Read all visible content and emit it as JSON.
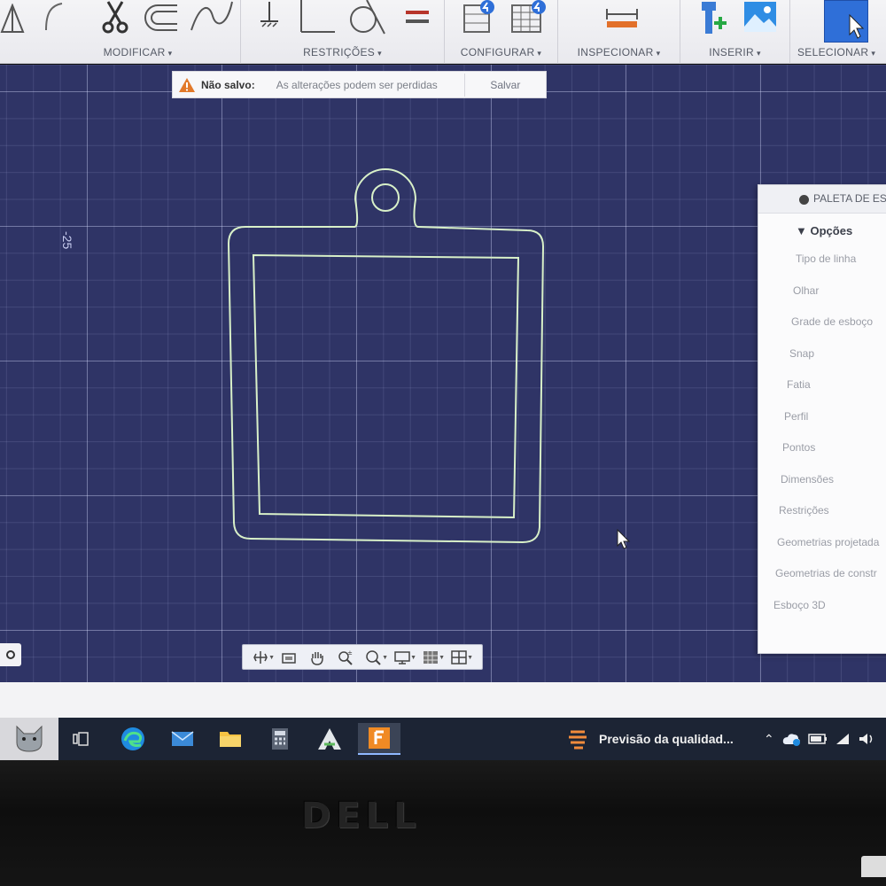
{
  "ribbon": {
    "groups": [
      {
        "label": "MODIFICAR"
      },
      {
        "label": "RESTRIÇÕES"
      },
      {
        "label": "CONFIGURAR"
      },
      {
        "label": "INSPECIONAR"
      },
      {
        "label": "INSERIR"
      },
      {
        "label": "SELECIONAR"
      }
    ],
    "caret": "▾",
    "colors": {
      "accent_blue": "#2f6fd8",
      "constraint_red": "#c0392b",
      "inspect_orange": "#e2702a"
    }
  },
  "banner": {
    "icon": "warning-icon",
    "title": "Não salvo:",
    "message": "As alterações podem ser perdidas",
    "save_label": "Salvar"
  },
  "canvas": {
    "dimension_label": "-25",
    "background": "#2f3466",
    "sketch_line_color": "#d8f0c8"
  },
  "navbar": {
    "tools": [
      "orbit-icon",
      "look-at-icon",
      "pan-icon",
      "zoom-window-icon",
      "zoom-icon",
      "display-icon",
      "grid-icon",
      "viewports-icon"
    ]
  },
  "palette": {
    "title": "PALETA DE ES",
    "section": "Opções",
    "options": [
      "Tipo de linha",
      "Olhar",
      "Grade de esboço",
      "Snap",
      "Fatia",
      "Perfil",
      "Pontos",
      "Dimensões",
      "Restrições",
      "Geometrias projetada",
      "Geometrias de constr",
      "Esboço 3D"
    ]
  },
  "taskbar": {
    "weather_text": "Previsão da qualidad...",
    "apps": [
      "task-view-icon",
      "edge-icon",
      "mail-icon",
      "file-explorer-icon",
      "calculator-icon",
      "autodesk-icon",
      "fusion-icon"
    ]
  },
  "bezel": {
    "brand": "DELL"
  }
}
